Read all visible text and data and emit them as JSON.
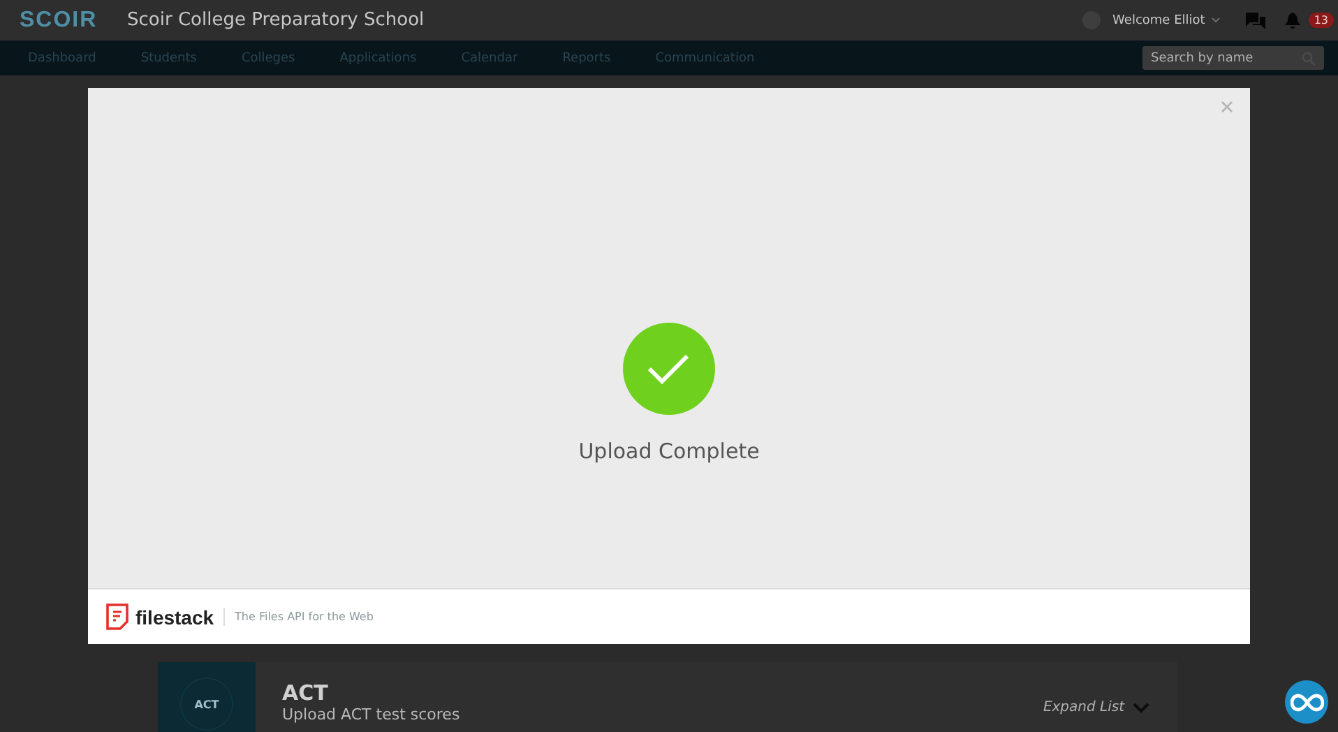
{
  "header": {
    "logo": "SCOIR",
    "school": "Scoir College Preparatory School",
    "welcome": "Welcome Elliot",
    "notification_count": "13"
  },
  "nav": {
    "items": [
      {
        "label": "Dashboard"
      },
      {
        "label": "Students"
      },
      {
        "label": "Colleges"
      },
      {
        "label": "Applications"
      },
      {
        "label": "Calendar"
      },
      {
        "label": "Reports"
      },
      {
        "label": "Communication"
      }
    ],
    "search": {
      "placeholder": "Search by name"
    }
  },
  "background_card": {
    "badge": "ACT",
    "title": "ACT",
    "subtitle": "Upload ACT test scores",
    "expand": "Expand List"
  },
  "modal": {
    "status": "Upload Complete",
    "footer": {
      "brand": "filestack",
      "tagline": "The Files API for the Web"
    }
  }
}
